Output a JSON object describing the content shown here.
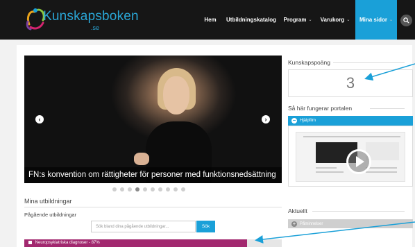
{
  "brand": {
    "name": "Kunskapsboken",
    "suffix": ".se"
  },
  "nav": {
    "items": [
      {
        "label": "Hem",
        "caret": ""
      },
      {
        "label": "Utbildningskatalog",
        "caret": ""
      },
      {
        "label": "Program",
        "caret": "⌄"
      },
      {
        "label": "Varukorg",
        "caret": "⌄"
      },
      {
        "label": "Mina sidor",
        "caret": "⌄"
      }
    ]
  },
  "slider": {
    "caption": "FN:s konvention om rättigheter för personer med funktionsnedsättning",
    "dots_total": 10,
    "active_dot": 3,
    "prev_glyph": "‹",
    "next_glyph": "›"
  },
  "my_courses": {
    "heading": "Mina utbildningar",
    "ongoing_label": "Pågående utbildningar",
    "search_placeholder": "Sök bland dina pågående utbildningar...",
    "search_button": "Sök",
    "course": "Neuropsykiatriska diagnoser - 87%"
  },
  "points": {
    "heading": "Kunskapspoäng",
    "value": "3"
  },
  "portal": {
    "heading": "Så här fungerar portalen",
    "help_label": "Hjälpfilm"
  },
  "news": {
    "heading": "Aktuellt",
    "reminders_label": "Påminnelser"
  },
  "colors": {
    "accent": "#1aa0d8",
    "course_bar": "#a2286f",
    "annotation": "#1aa0d8"
  }
}
